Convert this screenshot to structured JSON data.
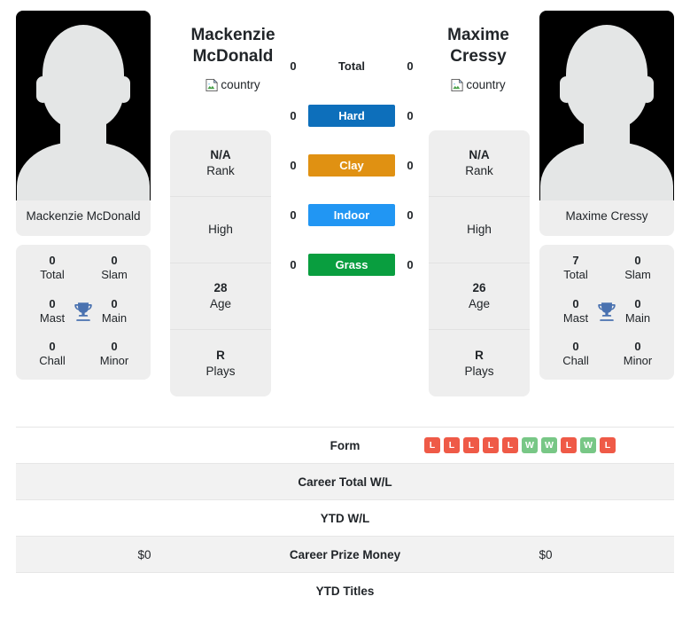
{
  "players": {
    "left": {
      "first_name": "Mackenzie",
      "last_name": "McDonald",
      "full_name": "Mackenzie McDonald",
      "country_alt": "country",
      "avatar_alt": "player photo",
      "trophies": [
        {
          "value": "0",
          "label": "Total"
        },
        {
          "value": "0",
          "label": "Slam"
        },
        {
          "value": "0",
          "label": "Mast"
        },
        {
          "value": "0",
          "label": "Main"
        },
        {
          "value": "0",
          "label": "Chall"
        },
        {
          "value": "0",
          "label": "Minor"
        }
      ],
      "info": [
        {
          "value": "N/A",
          "label": "Rank"
        },
        {
          "value": "",
          "label": "High"
        },
        {
          "value": "28",
          "label": "Age"
        },
        {
          "value": "R",
          "label": "Plays"
        }
      ],
      "surface_counts": {
        "total": "0",
        "hard": "0",
        "clay": "0",
        "indoor": "0",
        "grass": "0"
      },
      "career_total_wl": "",
      "ytd_wl": "",
      "career_prize_money": "$0",
      "ytd_titles": ""
    },
    "right": {
      "first_name": "Maxime",
      "last_name": "Cressy",
      "full_name": "Maxime Cressy",
      "country_alt": "country",
      "avatar_alt": "player photo",
      "trophies": [
        {
          "value": "7",
          "label": "Total"
        },
        {
          "value": "0",
          "label": "Slam"
        },
        {
          "value": "0",
          "label": "Mast"
        },
        {
          "value": "0",
          "label": "Main"
        },
        {
          "value": "0",
          "label": "Chall"
        },
        {
          "value": "0",
          "label": "Minor"
        }
      ],
      "info": [
        {
          "value": "N/A",
          "label": "Rank"
        },
        {
          "value": "",
          "label": "High"
        },
        {
          "value": "26",
          "label": "Age"
        },
        {
          "value": "R",
          "label": "Plays"
        }
      ],
      "surface_counts": {
        "total": "0",
        "hard": "0",
        "clay": "0",
        "indoor": "0",
        "grass": "0"
      },
      "career_total_wl": "",
      "ytd_wl": "",
      "career_prize_money": "$0",
      "ytd_titles": ""
    }
  },
  "surfaces": [
    {
      "key": "total",
      "label": "Total",
      "color": "transparent",
      "text_color": "#212529"
    },
    {
      "key": "hard",
      "label": "Hard",
      "color": "#0d6fbb",
      "text_color": "#ffffff"
    },
    {
      "key": "clay",
      "label": "Clay",
      "color": "#e09112",
      "text_color": "#ffffff"
    },
    {
      "key": "indoor",
      "label": "Indoor",
      "color": "#2196f3",
      "text_color": "#ffffff"
    },
    {
      "key": "grass",
      "label": "Grass",
      "color": "#099e3f",
      "text_color": "#ffffff"
    }
  ],
  "comparison_rows": [
    {
      "label": "Form",
      "left": "",
      "right": "",
      "type": "form",
      "striped": false
    },
    {
      "label": "Career Total W/L",
      "left": "",
      "right": "",
      "type": "text",
      "striped": true
    },
    {
      "label": "YTD W/L",
      "left": "",
      "right": "",
      "type": "text",
      "striped": false
    },
    {
      "label": "Career Prize Money",
      "left": "$0",
      "right": "$0",
      "type": "text",
      "striped": true
    },
    {
      "label": "YTD Titles",
      "left": "",
      "right": "",
      "type": "text",
      "striped": false
    }
  ],
  "form": {
    "left": [],
    "right": [
      "L",
      "L",
      "L",
      "L",
      "L",
      "W",
      "W",
      "L",
      "W",
      "L"
    ]
  },
  "colors": {
    "win_badge": "#ef5a47",
    "loss_badge": "#ef5a47",
    "win": "#78c786",
    "loss": "#ef5a47",
    "card_bg": "#eeeeee",
    "stripe": "#f2f2f2",
    "trophy": "#4a72b0"
  },
  "icons": {
    "trophy": "trophy-icon",
    "broken_image": "broken-image-icon"
  }
}
